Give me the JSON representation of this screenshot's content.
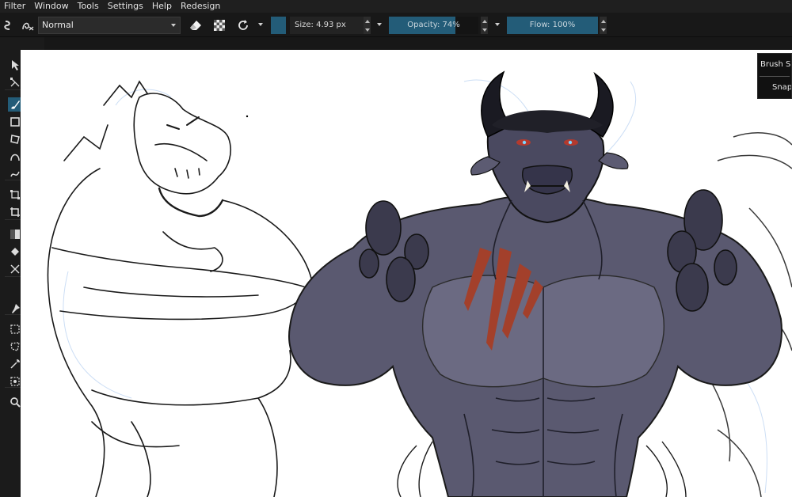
{
  "menu": [
    "Filter",
    "Window",
    "Tools",
    "Settings",
    "Help",
    "Redesign"
  ],
  "options": {
    "blend_mode": "Normal",
    "size_label": "Size: 4.93 px",
    "opacity_label": "Opacity: 74%",
    "opacity_value": 0.74,
    "flow_label": "Flow: 100%",
    "flow_value": 1.0,
    "brush_color": "#235c78"
  },
  "float_panel": {
    "brush_smoothing": "Brush Smoothing",
    "snap": "Snap"
  },
  "toolbox_icons": [
    "select-icon",
    "text-icon",
    "transform-node-icon",
    "pen-icon",
    "brush-icon",
    "line-icon",
    "rectangle-icon",
    "ellipse-icon",
    "polygon-icon",
    "polyline-icon",
    "bezier-icon",
    "bezier-select-icon",
    "freehand-path-icon",
    "calligraphy-icon",
    "transform-icon",
    "move-icon",
    "crop-icon",
    "gradient-icon",
    "color-picker-icon",
    "fill-icon",
    "smart-patch-icon",
    "pattern-edit-icon",
    "assistant-icon",
    "measure-icon",
    "reference-pin-icon",
    "rect-select-icon",
    "ellipse-select-icon",
    "poly-select-icon",
    "outline-select-icon",
    "magic-wand-icon",
    "contiguous-select-icon",
    "similar-select-icon",
    "bezier-path-select-icon",
    "zoom-icon",
    "pan-icon"
  ]
}
